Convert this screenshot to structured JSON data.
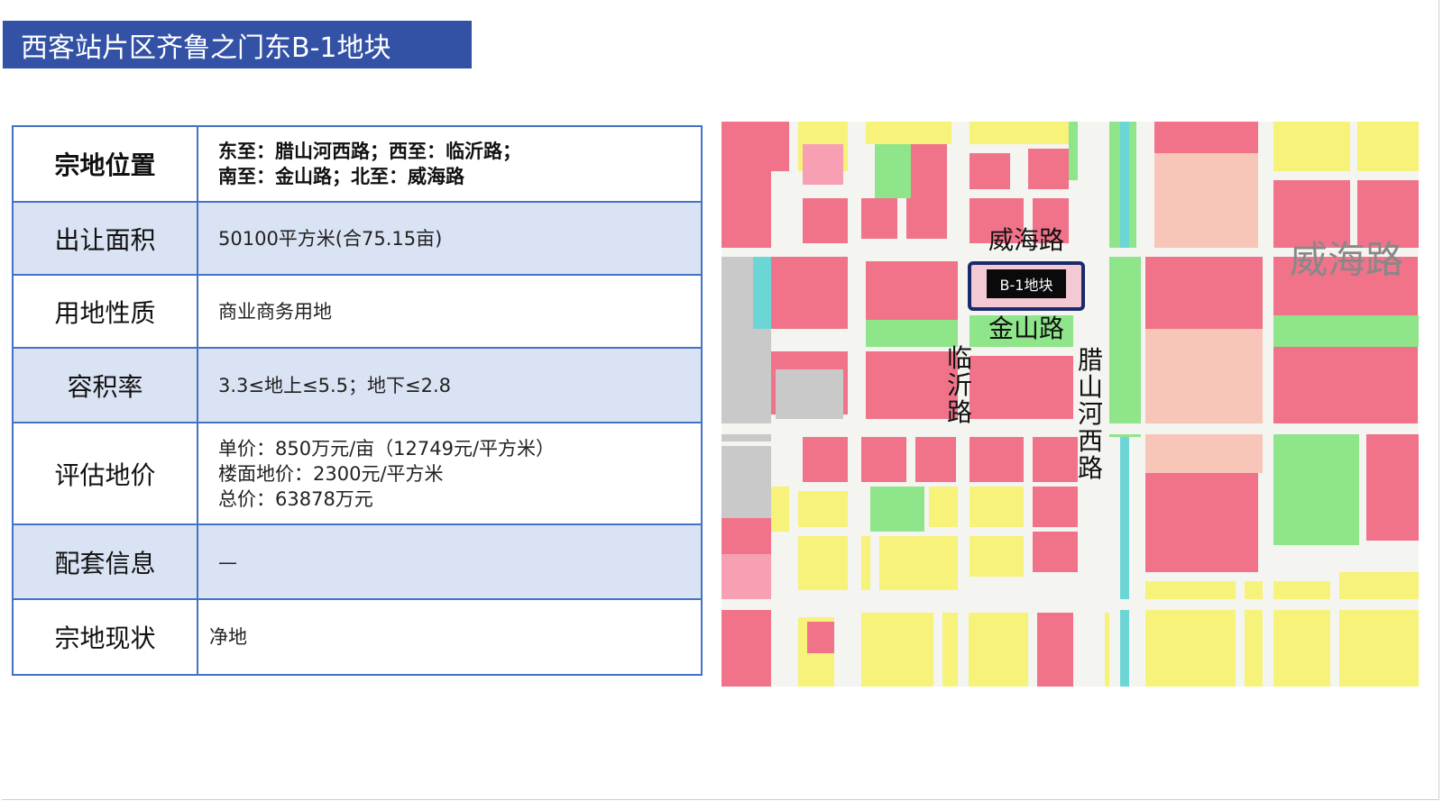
{
  "title": "西客站片区齐鲁之门东B-1地块",
  "rows": [
    {
      "label": "宗地位置",
      "lines": [
        "东至：腊山河西路；西至：临沂路；",
        "南至：金山路；北至：威海路"
      ]
    },
    {
      "label": "出让面积",
      "lines": [
        "50100平方米(合75.15亩)"
      ]
    },
    {
      "label": "用地性质",
      "lines": [
        "商业商务用地"
      ]
    },
    {
      "label": "容积率",
      "lines": [
        "3.3≤地上≤5.5；地下≤2.8"
      ]
    },
    {
      "label": "评估地价",
      "lines": [
        "单价：850万元/亩（12749元/平方米）",
        "楼面地价：2300元/平方米",
        "总价：63878万元"
      ]
    },
    {
      "label": "配套信息",
      "lines": [
        "—"
      ]
    },
    {
      "label": "宗地现状",
      "lines": [
        "净地"
      ]
    }
  ],
  "map": {
    "road_weihai": "威海路",
    "road_weihai_far": "威海路",
    "road_jinshan": "金山路",
    "road_linyi": "临沂路",
    "road_lashanhexi": "腊山河西路",
    "parcel_label": "B-1地块",
    "colors": {
      "commercial": "#f0738a",
      "commercial_light": "#f7a0b3",
      "residential": "#f6f27a",
      "green": "#8fe58a",
      "water": "#6cd6d6",
      "road": "#f4f4f0",
      "salmon": "#f7c6b8",
      "gray": "#c9c9c9"
    }
  }
}
